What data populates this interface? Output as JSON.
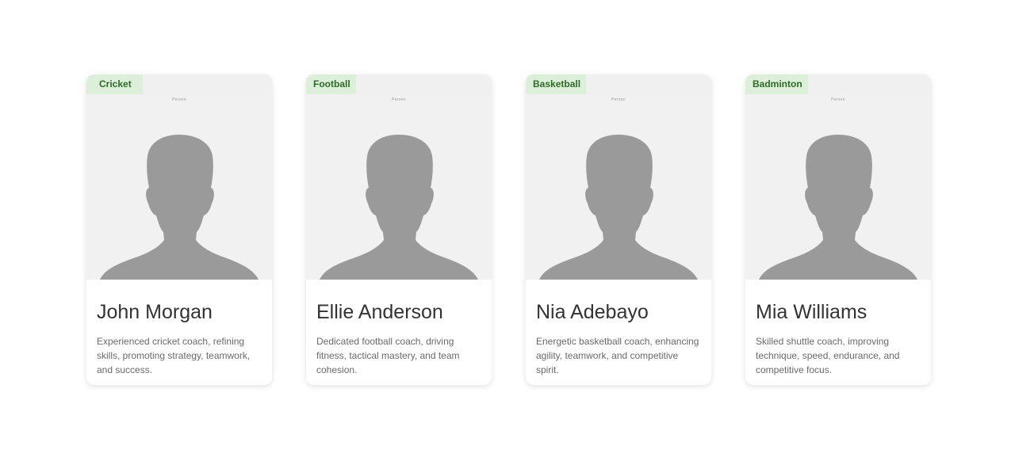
{
  "coaches": [
    {
      "sport": "Cricket",
      "photo_caption": "Person",
      "name": "John Morgan",
      "description": "Experienced cricket coach, refining skills, promoting strategy, teamwork, and success."
    },
    {
      "sport": "Football",
      "photo_caption": "Person",
      "name": "Ellie Anderson",
      "description": "Dedicated football coach, driving fitness, tactical mastery, and team cohesion."
    },
    {
      "sport": "Basketball",
      "photo_caption": "Person",
      "name": "Nia Adebayo",
      "description": "Energetic basketball coach, enhancing agility, teamwork, and competitive spirit."
    },
    {
      "sport": "Badminton",
      "photo_caption": "Person",
      "name": "Mia Williams",
      "description": "Skilled shuttle coach, improving technique, speed, endurance, and competitive focus."
    }
  ],
  "colors": {
    "tag_background": "#dcefd8",
    "tag_text": "#2f6a2a",
    "silhouette": "#9a9a9a",
    "photo_background": "#f1f1f1"
  },
  "icons": {
    "photo_placeholder": "person-silhouette-icon"
  }
}
